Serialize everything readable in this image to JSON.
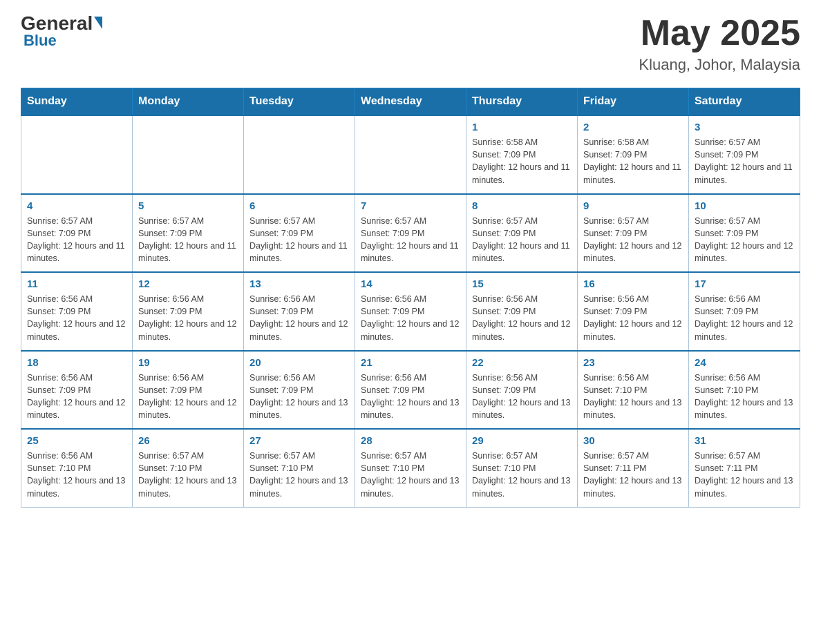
{
  "header": {
    "logo_general": "General",
    "logo_blue": "Blue",
    "title": "May 2025",
    "subtitle": "Kluang, Johor, Malaysia"
  },
  "weekdays": [
    "Sunday",
    "Monday",
    "Tuesday",
    "Wednesday",
    "Thursday",
    "Friday",
    "Saturday"
  ],
  "weeks": [
    [
      {
        "day": "",
        "info": ""
      },
      {
        "day": "",
        "info": ""
      },
      {
        "day": "",
        "info": ""
      },
      {
        "day": "",
        "info": ""
      },
      {
        "day": "1",
        "info": "Sunrise: 6:58 AM\nSunset: 7:09 PM\nDaylight: 12 hours and 11 minutes."
      },
      {
        "day": "2",
        "info": "Sunrise: 6:58 AM\nSunset: 7:09 PM\nDaylight: 12 hours and 11 minutes."
      },
      {
        "day": "3",
        "info": "Sunrise: 6:57 AM\nSunset: 7:09 PM\nDaylight: 12 hours and 11 minutes."
      }
    ],
    [
      {
        "day": "4",
        "info": "Sunrise: 6:57 AM\nSunset: 7:09 PM\nDaylight: 12 hours and 11 minutes."
      },
      {
        "day": "5",
        "info": "Sunrise: 6:57 AM\nSunset: 7:09 PM\nDaylight: 12 hours and 11 minutes."
      },
      {
        "day": "6",
        "info": "Sunrise: 6:57 AM\nSunset: 7:09 PM\nDaylight: 12 hours and 11 minutes."
      },
      {
        "day": "7",
        "info": "Sunrise: 6:57 AM\nSunset: 7:09 PM\nDaylight: 12 hours and 11 minutes."
      },
      {
        "day": "8",
        "info": "Sunrise: 6:57 AM\nSunset: 7:09 PM\nDaylight: 12 hours and 11 minutes."
      },
      {
        "day": "9",
        "info": "Sunrise: 6:57 AM\nSunset: 7:09 PM\nDaylight: 12 hours and 12 minutes."
      },
      {
        "day": "10",
        "info": "Sunrise: 6:57 AM\nSunset: 7:09 PM\nDaylight: 12 hours and 12 minutes."
      }
    ],
    [
      {
        "day": "11",
        "info": "Sunrise: 6:56 AM\nSunset: 7:09 PM\nDaylight: 12 hours and 12 minutes."
      },
      {
        "day": "12",
        "info": "Sunrise: 6:56 AM\nSunset: 7:09 PM\nDaylight: 12 hours and 12 minutes."
      },
      {
        "day": "13",
        "info": "Sunrise: 6:56 AM\nSunset: 7:09 PM\nDaylight: 12 hours and 12 minutes."
      },
      {
        "day": "14",
        "info": "Sunrise: 6:56 AM\nSunset: 7:09 PM\nDaylight: 12 hours and 12 minutes."
      },
      {
        "day": "15",
        "info": "Sunrise: 6:56 AM\nSunset: 7:09 PM\nDaylight: 12 hours and 12 minutes."
      },
      {
        "day": "16",
        "info": "Sunrise: 6:56 AM\nSunset: 7:09 PM\nDaylight: 12 hours and 12 minutes."
      },
      {
        "day": "17",
        "info": "Sunrise: 6:56 AM\nSunset: 7:09 PM\nDaylight: 12 hours and 12 minutes."
      }
    ],
    [
      {
        "day": "18",
        "info": "Sunrise: 6:56 AM\nSunset: 7:09 PM\nDaylight: 12 hours and 12 minutes."
      },
      {
        "day": "19",
        "info": "Sunrise: 6:56 AM\nSunset: 7:09 PM\nDaylight: 12 hours and 12 minutes."
      },
      {
        "day": "20",
        "info": "Sunrise: 6:56 AM\nSunset: 7:09 PM\nDaylight: 12 hours and 13 minutes."
      },
      {
        "day": "21",
        "info": "Sunrise: 6:56 AM\nSunset: 7:09 PM\nDaylight: 12 hours and 13 minutes."
      },
      {
        "day": "22",
        "info": "Sunrise: 6:56 AM\nSunset: 7:09 PM\nDaylight: 12 hours and 13 minutes."
      },
      {
        "day": "23",
        "info": "Sunrise: 6:56 AM\nSunset: 7:10 PM\nDaylight: 12 hours and 13 minutes."
      },
      {
        "day": "24",
        "info": "Sunrise: 6:56 AM\nSunset: 7:10 PM\nDaylight: 12 hours and 13 minutes."
      }
    ],
    [
      {
        "day": "25",
        "info": "Sunrise: 6:56 AM\nSunset: 7:10 PM\nDaylight: 12 hours and 13 minutes."
      },
      {
        "day": "26",
        "info": "Sunrise: 6:57 AM\nSunset: 7:10 PM\nDaylight: 12 hours and 13 minutes."
      },
      {
        "day": "27",
        "info": "Sunrise: 6:57 AM\nSunset: 7:10 PM\nDaylight: 12 hours and 13 minutes."
      },
      {
        "day": "28",
        "info": "Sunrise: 6:57 AM\nSunset: 7:10 PM\nDaylight: 12 hours and 13 minutes."
      },
      {
        "day": "29",
        "info": "Sunrise: 6:57 AM\nSunset: 7:10 PM\nDaylight: 12 hours and 13 minutes."
      },
      {
        "day": "30",
        "info": "Sunrise: 6:57 AM\nSunset: 7:11 PM\nDaylight: 12 hours and 13 minutes."
      },
      {
        "day": "31",
        "info": "Sunrise: 6:57 AM\nSunset: 7:11 PM\nDaylight: 12 hours and 13 minutes."
      }
    ]
  ]
}
